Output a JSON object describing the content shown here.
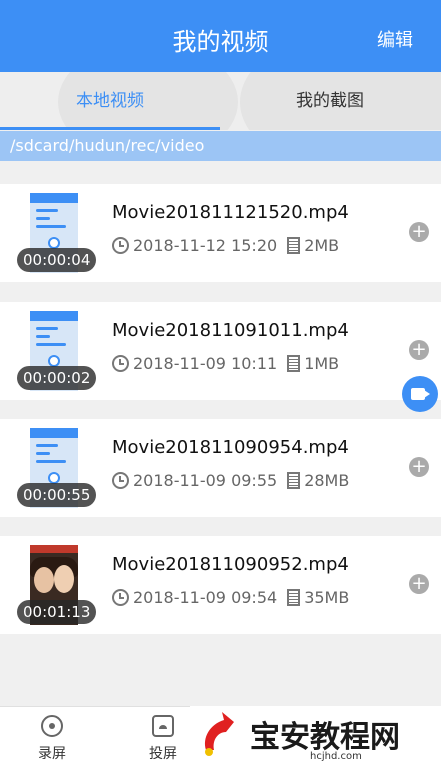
{
  "header": {
    "title": "我的视频",
    "edit_label": "编辑"
  },
  "tabs": [
    {
      "label": "本地视频",
      "active": true
    },
    {
      "label": "我的截图",
      "active": false
    }
  ],
  "path": "/sdcard/hudun/rec/video",
  "videos": [
    {
      "duration": "00:00:04",
      "name": "Movie201811121520.mp4",
      "datetime": "2018-11-12 15:20",
      "size": "2MB",
      "thumb": "screen"
    },
    {
      "duration": "00:00:02",
      "name": "Movie201811091011.mp4",
      "datetime": "2018-11-09 10:11",
      "size": "1MB",
      "thumb": "screen"
    },
    {
      "duration": "00:00:55",
      "name": "Movie201811090954.mp4",
      "datetime": "2018-11-09 09:55",
      "size": "28MB",
      "thumb": "screen"
    },
    {
      "duration": "00:01:13",
      "name": "Movie201811090952.mp4",
      "datetime": "2018-11-09 09:54",
      "size": "35MB",
      "thumb": "photo"
    }
  ],
  "bottom_nav": [
    {
      "label": "录屏",
      "icon": "record-icon"
    },
    {
      "label": "投屏",
      "icon": "cast-icon"
    }
  ],
  "watermark": {
    "text": "宝安教程网",
    "url": "hcjhd.com"
  },
  "colors": {
    "primary": "#3d8ff5",
    "path_bar": "#9cc5f5"
  }
}
